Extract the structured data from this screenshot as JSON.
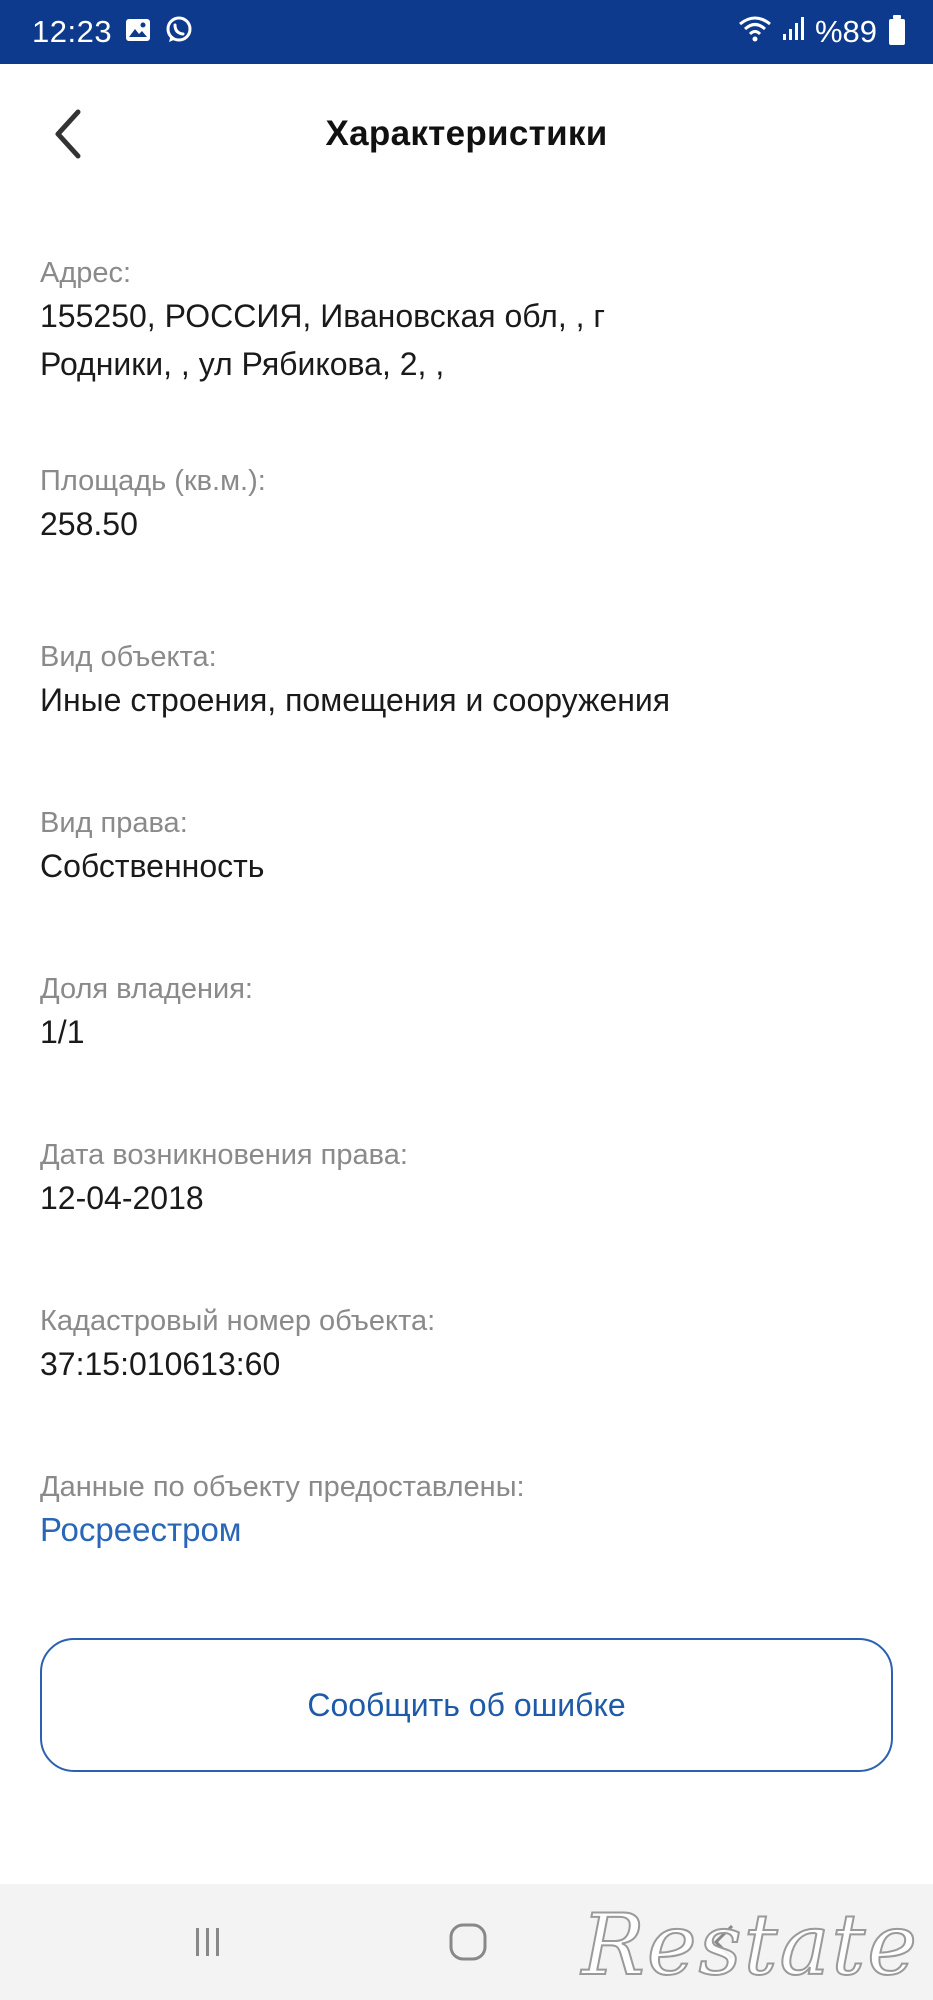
{
  "status_bar": {
    "time": "12:23",
    "battery": "%89"
  },
  "header": {
    "title": "Характеристики"
  },
  "fields": [
    {
      "label": "Адрес:",
      "value_line1": "155250, РОССИЯ, Ивановская обл, , г",
      "value_line2": "Родники, , ул Рябикова, 2, ,"
    },
    {
      "label": "Площадь (кв.м.):",
      "value": "258.50"
    },
    {
      "label": "Вид объекта:",
      "value": "Иные строения, помещения и сооружения"
    },
    {
      "label": "Вид права:",
      "value": "Собственность"
    },
    {
      "label": "Доля владения:",
      "value": "1/1"
    },
    {
      "label": "Дата возникновения права:",
      "value": "12-04-2018"
    },
    {
      "label": "Кадастровый номер объекта:",
      "value": "37:15:010613:60"
    },
    {
      "label": "Данные по объекту предоставлены:",
      "value": "Росреестром"
    }
  ],
  "report_button": {
    "label": "Сообщить об ошибке"
  },
  "watermark": "Restate",
  "colors": {
    "status_bar": "#0d3a8c",
    "link": "#2a66b8",
    "button_border": "#2b61b0"
  }
}
